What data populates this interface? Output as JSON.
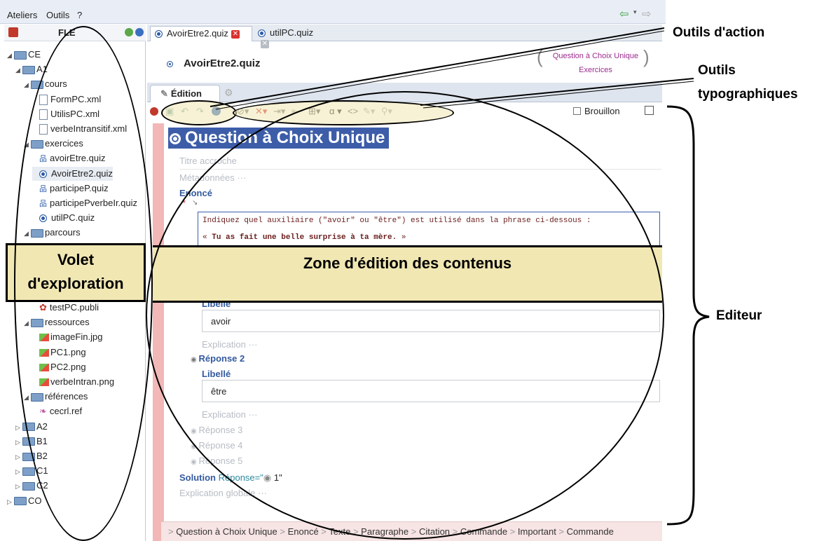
{
  "menubar": {
    "items": [
      "Ateliers",
      "Outils",
      "?"
    ]
  },
  "explorer": {
    "title": "FLE",
    "tree": [
      {
        "label": "CE",
        "kind": "folder",
        "depth": 0
      },
      {
        "label": "A1",
        "kind": "folder",
        "depth": 1
      },
      {
        "label": "cours",
        "kind": "folder",
        "depth": 2
      },
      {
        "label": "FormPC.xml",
        "kind": "file",
        "depth": 3
      },
      {
        "label": "UtilisPC.xml",
        "kind": "file",
        "depth": 3
      },
      {
        "label": "verbeIntransitif.xml",
        "kind": "file",
        "depth": 3
      },
      {
        "label": "exercices",
        "kind": "folder",
        "depth": 2
      },
      {
        "label": "avoirEtre.quiz",
        "kind": "quiz",
        "depth": 3
      },
      {
        "label": "AvoirEtre2.quiz",
        "kind": "radio",
        "depth": 3
      },
      {
        "label": "participeP.quiz",
        "kind": "quiz",
        "depth": 3
      },
      {
        "label": "participePverbeIr.quiz",
        "kind": "quiz",
        "depth": 3
      },
      {
        "label": "utilPC.quiz",
        "kind": "radio",
        "depth": 3
      },
      {
        "label": "parcours",
        "kind": "folder",
        "depth": 2
      },
      {
        "label": "testPC.publi",
        "kind": "publi",
        "depth": 3
      },
      {
        "label": "ressources",
        "kind": "folder",
        "depth": 2
      },
      {
        "label": "imageFin.jpg",
        "kind": "image",
        "depth": 3
      },
      {
        "label": "PC1.png",
        "kind": "image",
        "depth": 3
      },
      {
        "label": "PC2.png",
        "kind": "image",
        "depth": 3
      },
      {
        "label": "verbeIntran.png",
        "kind": "image",
        "depth": 3
      },
      {
        "label": "références",
        "kind": "folder",
        "depth": 2
      },
      {
        "label": "cecrl.ref",
        "kind": "ref",
        "depth": 3
      },
      {
        "label": "A2",
        "kind": "folder",
        "depth": 1
      },
      {
        "label": "B1",
        "kind": "folder",
        "depth": 1
      },
      {
        "label": "B2",
        "kind": "folder",
        "depth": 1
      },
      {
        "label": "C1",
        "kind": "folder",
        "depth": 1
      },
      {
        "label": "C2",
        "kind": "folder",
        "depth": 1
      },
      {
        "label": "CO",
        "kind": "folder",
        "depth": 0
      }
    ]
  },
  "tabs": [
    {
      "label": "AvoirEtre2.quiz"
    },
    {
      "label": "utilPC.quiz"
    }
  ],
  "doc": {
    "title": "AvoirEtre2.quiz",
    "type_line1": "Question à Choix Unique",
    "type_line2": "Exercices",
    "subtab": "Édition",
    "brouillon": "Brouillon"
  },
  "toolbar": {
    "alpha": "α",
    "code": "<>"
  },
  "content": {
    "heading": "Question à Choix Unique",
    "titre_placeholder": "Titre accroche",
    "metadonnees": "Métadonnées",
    "enonce": "Enoncé",
    "enonce_line1": "Indiquez quel auxiliaire (\"avoir\" ou \"être\") est utilisé dans la phrase ci-dessous :",
    "enonce_quote_open": "«",
    "enonce_line2": "Tu as fait une belle surprise à ta mère.",
    "enonce_quote_close": "»",
    "libelle": "Libellé",
    "rep1_value": "avoir",
    "explication": "Explication",
    "reponse2": "Réponse 2",
    "rep2_value": "être",
    "reponse3": "Réponse 3",
    "reponse4": "Réponse 4",
    "reponse5": "Réponse 5",
    "solution_label": "Solution",
    "solution_value": "Réponse=\"",
    "solution_number": "1\"",
    "explication_globale": "Explication globale"
  },
  "breadcrumb": [
    "Question à Choix Unique",
    "Enoncé",
    "Texte",
    "Paragraphe",
    "Citation",
    "Commande",
    "Important",
    "Commande"
  ],
  "annotations": {
    "outils_action": "Outils d'action",
    "outils_typo_1": "Outils",
    "outils_typo_2": "typographiques",
    "volet_1": "Volet",
    "volet_2": "d'exploration",
    "zone": "Zone d'édition des contenus",
    "editeur": "Editeur"
  },
  "colors": {
    "accent": "#335a9e",
    "heading_bg": "#3d5da9",
    "annotation_band": "#f1e7b3",
    "red_margin": "#f2b7b7"
  }
}
